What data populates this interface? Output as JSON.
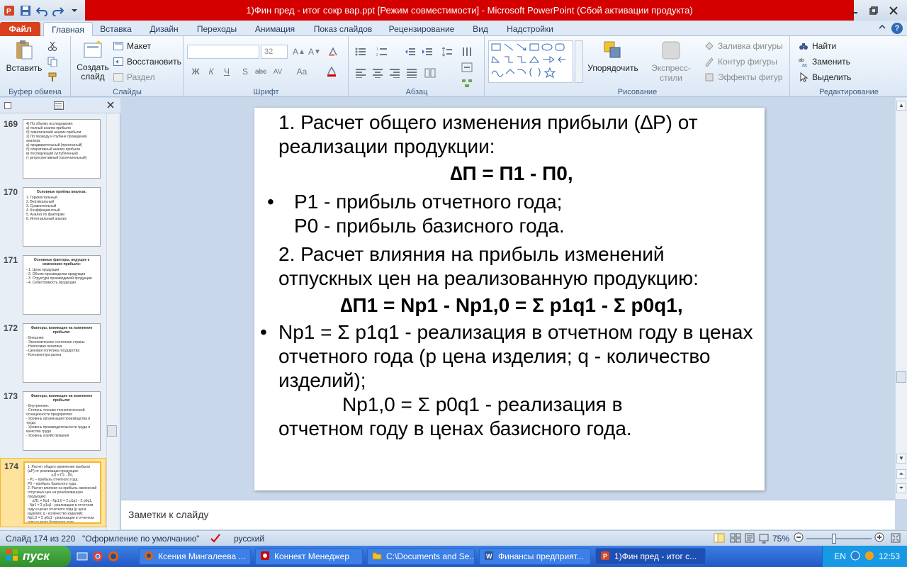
{
  "window": {
    "title": "1)Фин пред - итог сокр вар.ppt [Режим совместимости]  -  Microsoft PowerPoint (Сбой активации продукта)"
  },
  "tabs": [
    {
      "label": "Файл"
    },
    {
      "label": "Главная"
    },
    {
      "label": "Вставка"
    },
    {
      "label": "Дизайн"
    },
    {
      "label": "Переходы"
    },
    {
      "label": "Анимация"
    },
    {
      "label": "Показ слайдов"
    },
    {
      "label": "Рецензирование"
    },
    {
      "label": "Вид"
    },
    {
      "label": "Надстройки"
    }
  ],
  "ribbon": {
    "clipboard": {
      "label": "Буфер обмена",
      "paste": "Вставить"
    },
    "slides": {
      "label": "Слайды",
      "new_slide_1": "Создать",
      "new_slide_2": "слайд",
      "layout": "Макет",
      "reset": "Восстановить",
      "section": "Раздел"
    },
    "font": {
      "label": "Шрифт",
      "size": "32"
    },
    "paragraph": {
      "label": "Абзац"
    },
    "drawing": {
      "label": "Рисование",
      "arrange": "Упорядочить",
      "styles": "Экспресс-стили",
      "fill": "Заливка фигуры",
      "outline": "Контур фигуры",
      "effects": "Эффекты фигур"
    },
    "editing": {
      "label": "Редактирование",
      "find": "Найти",
      "replace": "Заменить",
      "select": "Выделить"
    }
  },
  "thumbnails": [
    {
      "num": "169",
      "title": "",
      "lines": [
        "4) По объему исследования:",
        "а) полный анализ прибыли",
        "б) тематический анализ прибыли",
        "2) По периоду и глубине проведения анализа:",
        "а) предварительный (прогнозный)",
        "б) оперативный анализ прибыли",
        "в) последующий (углубленный)",
        "г) ретроспективный (окончательный)"
      ]
    },
    {
      "num": "170",
      "title": "Основные приёмы анализа:",
      "lines": [
        "1. Горизонтальный",
        "2. Вертикальный",
        "3. Сравнительный",
        "4. Коэффициентный",
        "5. Анализ по факторам",
        "6. Интегральный анализ"
      ]
    },
    {
      "num": "171",
      "title": "Основные факторы, ведущие к изменению прибыли:",
      "lines": [
        "- 1. Цена продукции",
        "- 2. Объем производства продукции",
        "- 3. Структура производимой продукции",
        "- 4. Себестоимость продукции"
      ]
    },
    {
      "num": "172",
      "title": "Факторы, влияющие на изменение прибыли:",
      "lines": [
        "- Внешние:",
        "- Экономическое состояние страны",
        "- Налоговая политика",
        "- Ценовая политика государства",
        "- Конъюнктура рынка"
      ]
    },
    {
      "num": "173",
      "title": "Факторы, влияющие на изменение прибыли:",
      "lines": [
        "- Внутренние:",
        "- Степень технико-технологической оснащенности предприятия",
        "- Уровень организации производства и труда",
        "- Уровень производительности труда и качества труда",
        "- Уровень хозяйствования"
      ]
    },
    {
      "num": "174",
      "title": "",
      "lines": [
        "1. Расчет общего изменения прибыли (∆P) от реализации продукции:",
        "∆П = П1 - П0,",
        "- Р1 – прибыль отчетного года;",
        "Р0 – прибыль базисного года.",
        "2. Расчет влияния на прибыль изменений отпускных цен на реализованную продукцию:",
        "∆П1 = Np1 - Np1,0 = Σ p1q1 - Σ p0q1,",
        "- Np1 = Σ p1q1 - реализация в отчетном году в ценах отчетного года (p цена изделия; q - количество изделий);",
        "Np1,0 = Σ p0q1 - реализация в отчетном году в ценах базисного года."
      ]
    }
  ],
  "slide": {
    "p1": "1. Расчет общего изменения прибыли  (∆P) от реализации продукции:",
    "f1": "∆П = П1 - П0,",
    "b1": "•",
    "p2": "Р1 - прибыль отчетного года;",
    "p3": "Р0 - прибыль базисного года.",
    "p4": "2. Расчет влияния на прибыль изменений отпускных цен на реализованную продукцию:",
    "f2": "∆П1 = Np1 - Np1,0 =  Σ p1q1 - Σ p0q1,",
    "b2": "•",
    "p5": "Np1 = Σ p1q1  - реализация в отчетном году в ценах отчетного года (p цена изделия; q - количество изделий);",
    "p6": "Np1,0 = Σ p0q1 - реализация в",
    "p7": "отчетном году в ценах базисного года."
  },
  "notes": {
    "placeholder": "Заметки к слайду"
  },
  "status": {
    "slide": "Слайд 174 из 220",
    "theme": "\"Оформление по умолчанию\"",
    "lang": "русский",
    "zoom": "75%"
  },
  "taskbar": {
    "start": "пуск",
    "tasks": [
      {
        "label": "Ксения Мингалеева ..."
      },
      {
        "label": "Коннект Менеджер"
      },
      {
        "label": "C:\\Documents and Se..."
      },
      {
        "label": "Финансы предприят..."
      },
      {
        "label": "1)Фин пред - итог с..."
      }
    ],
    "lang": "EN",
    "time": "12:53"
  }
}
